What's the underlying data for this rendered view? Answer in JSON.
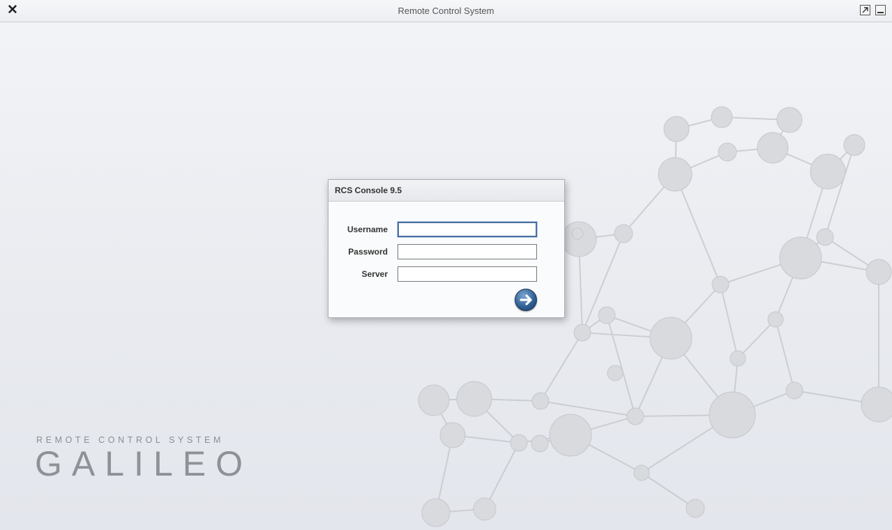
{
  "window": {
    "title": "Remote Control System"
  },
  "brand": {
    "subtitle": "REMOTE CONTROL SYSTEM",
    "name": "GALILEO"
  },
  "login": {
    "title": "RCS Console 9.5",
    "fields": [
      {
        "label": "Username",
        "value": "",
        "placeholder": ""
      },
      {
        "label": "Password",
        "value": "",
        "placeholder": ""
      },
      {
        "label": "Server",
        "value": "",
        "placeholder": ""
      }
    ],
    "submit_icon": "arrow-right-icon"
  },
  "colors": {
    "accent": "#2d5d91",
    "background": "#e9ebf0"
  }
}
